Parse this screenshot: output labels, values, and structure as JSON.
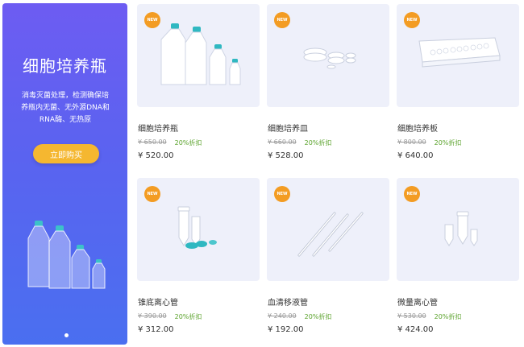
{
  "banner": {
    "title": "细胞培养瓶",
    "description": "消毒灭菌处理，检测确保培养瓶内无菌、无外源DNA和RNA酶、无热原",
    "button_label": "立即购买"
  },
  "products": [
    {
      "badge": "NEW",
      "name": "细胞培养瓶",
      "original_price": "¥ 650.00",
      "discount": "20%折扣",
      "price": "¥ 520.00"
    },
    {
      "badge": "NEW",
      "name": "细胞培养皿",
      "original_price": "¥ 660.00",
      "discount": "20%折扣",
      "price": "¥ 528.00"
    },
    {
      "badge": "NEW",
      "name": "细胞培养板",
      "original_price": "¥ 800.00",
      "discount": "20%折扣",
      "price": "¥ 640.00"
    },
    {
      "badge": "NEW",
      "name": "锥底离心管",
      "original_price": "¥ 390.00",
      "discount": "20%折扣",
      "price": "¥ 312.00"
    },
    {
      "badge": "NEW",
      "name": "血清移液管",
      "original_price": "¥ 240.00",
      "discount": "20%折扣",
      "price": "¥ 192.00"
    },
    {
      "badge": "NEW",
      "name": "微量离心管",
      "original_price": "¥ 530.00",
      "discount": "20%折扣",
      "price": "¥ 424.00"
    }
  ],
  "colors": {
    "banner_start": "#6d5cf2",
    "banner_end": "#4a6ff0",
    "button": "#f5b730",
    "badge": "#f39c23",
    "discount": "#5aa22b",
    "card_bg": "#eef0fa"
  }
}
